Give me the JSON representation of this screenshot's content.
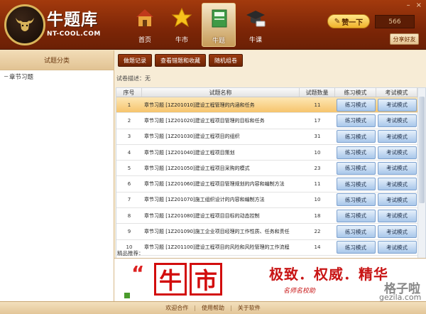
{
  "app": {
    "name_cn": "牛题库",
    "name_en": "NT-COOL.COM"
  },
  "nav": [
    {
      "label": "首页",
      "icon": "house-icon"
    },
    {
      "label": "牛市",
      "icon": "star-icon"
    },
    {
      "label": "牛题",
      "icon": "book-icon",
      "active": true
    },
    {
      "label": "牛课",
      "icon": "graduation-cap-icon"
    }
  ],
  "header": {
    "rank_label": "赞一下",
    "count": "566",
    "share_label": "分享好友"
  },
  "sidebar": {
    "title": "试题分类",
    "items": [
      {
        "label": "章节习题",
        "toggle": "−"
      }
    ]
  },
  "toolbar": {
    "buttons": [
      "做题记录",
      "查看错题和收藏",
      "随机组卷"
    ]
  },
  "description": "试卷描述：无",
  "table": {
    "headers": [
      "序号",
      "试题名称",
      "试题数量",
      "练习模式",
      "考试模式"
    ],
    "practice_label": "练习模式",
    "exam_label": "考试模式",
    "rows": [
      {
        "no": "1",
        "name": "章节习题 [1Z201010]建设工程管理的内涵和任务",
        "count": "11"
      },
      {
        "no": "2",
        "name": "章节习题 [1Z201020]建设工程项目管理的目标和任务",
        "count": "17"
      },
      {
        "no": "3",
        "name": "章节习题 [1Z201030]建设工程项目的组织",
        "count": "31"
      },
      {
        "no": "4",
        "name": "章节习题 [1Z201040]建设工程项目策划",
        "count": "10"
      },
      {
        "no": "5",
        "name": "章节习题 [1Z201050]建设工程项目采购的模式",
        "count": "23"
      },
      {
        "no": "6",
        "name": "章节习题 [1Z201060]建设工程项目管理规划的内容和编制方法",
        "count": "11"
      },
      {
        "no": "7",
        "name": "章节习题 [1Z201070]施工组织设计的内容和编制方法",
        "count": "10"
      },
      {
        "no": "8",
        "name": "章节习题 [1Z201080]建设工程项目目标的动态控制",
        "count": "18"
      },
      {
        "no": "9",
        "name": "章节习题 [1Z201090]施工企业项目经理的工作性质、任务和责任",
        "count": "22"
      },
      {
        "no": "10",
        "name": "章节习题 [1Z201100]建设工程项目的风险和风险管理的工作流程",
        "count": "14"
      }
    ]
  },
  "promo": {
    "label": "精品推荐：",
    "quote": "“",
    "stamp": [
      "牛",
      "市"
    ],
    "slogan": "极致．权威．精华",
    "sub": "名师名校助"
  },
  "watermark": {
    "line1": "格子啦",
    "line2": "gezila.com"
  },
  "footer": {
    "links": [
      "欢迎合作",
      "使用帮助",
      "关于软件"
    ]
  }
}
